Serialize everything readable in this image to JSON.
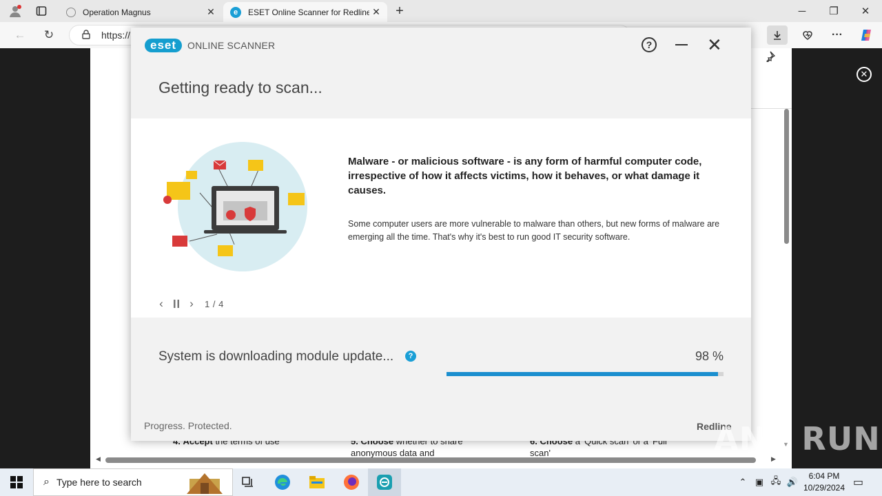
{
  "browser": {
    "tabs": [
      {
        "title": "Operation Magnus"
      },
      {
        "title": "ESET Online Scanner for Redline"
      }
    ],
    "address": "https://",
    "icons": {
      "profile": "profile-icon",
      "workspaces": "workspaces-icon",
      "back": "back-arrow-icon",
      "refresh": "refresh-icon",
      "lock": "lock-icon",
      "download": "download-icon",
      "extensions": "extensions-icon",
      "menu": "more-menu-icon",
      "copilot": "copilot-icon"
    }
  },
  "page": {
    "steps": [
      {
        "num": "4.",
        "bold": "Accept",
        "rest": " the terms of use"
      },
      {
        "num": "5.",
        "bold": "Choose",
        "rest": " whether to share anonymous data and"
      },
      {
        "num": "6.",
        "bold": "Choose",
        "rest": " a 'Quick scan' or a 'Full scan'"
      }
    ]
  },
  "eset": {
    "logo_badge": "eset",
    "logo_text": "ONLINE SCANNER",
    "title": "Getting ready to scan...",
    "info_heading": "Malware - or malicious software - is any form of harmful computer code, irrespective of how it affects victims, how it behaves, or what damage it causes.",
    "info_body": "Some computer users are more vulnerable to malware than others, but new forms of malware are emerging all the time. That's why it's best to run good IT security software.",
    "slide_counter": "1 / 4",
    "status_text": "System is downloading module update...",
    "progress_label": "98 %",
    "progress_value": 98,
    "footer_tagline": "Progress. Protected.",
    "footer_brand": "Redline",
    "accent_color": "#1b8fcf"
  },
  "watermark": "ANY RUN",
  "taskbar": {
    "search_placeholder": "Type here to search",
    "time": "6:04 PM",
    "date": "10/29/2024"
  }
}
